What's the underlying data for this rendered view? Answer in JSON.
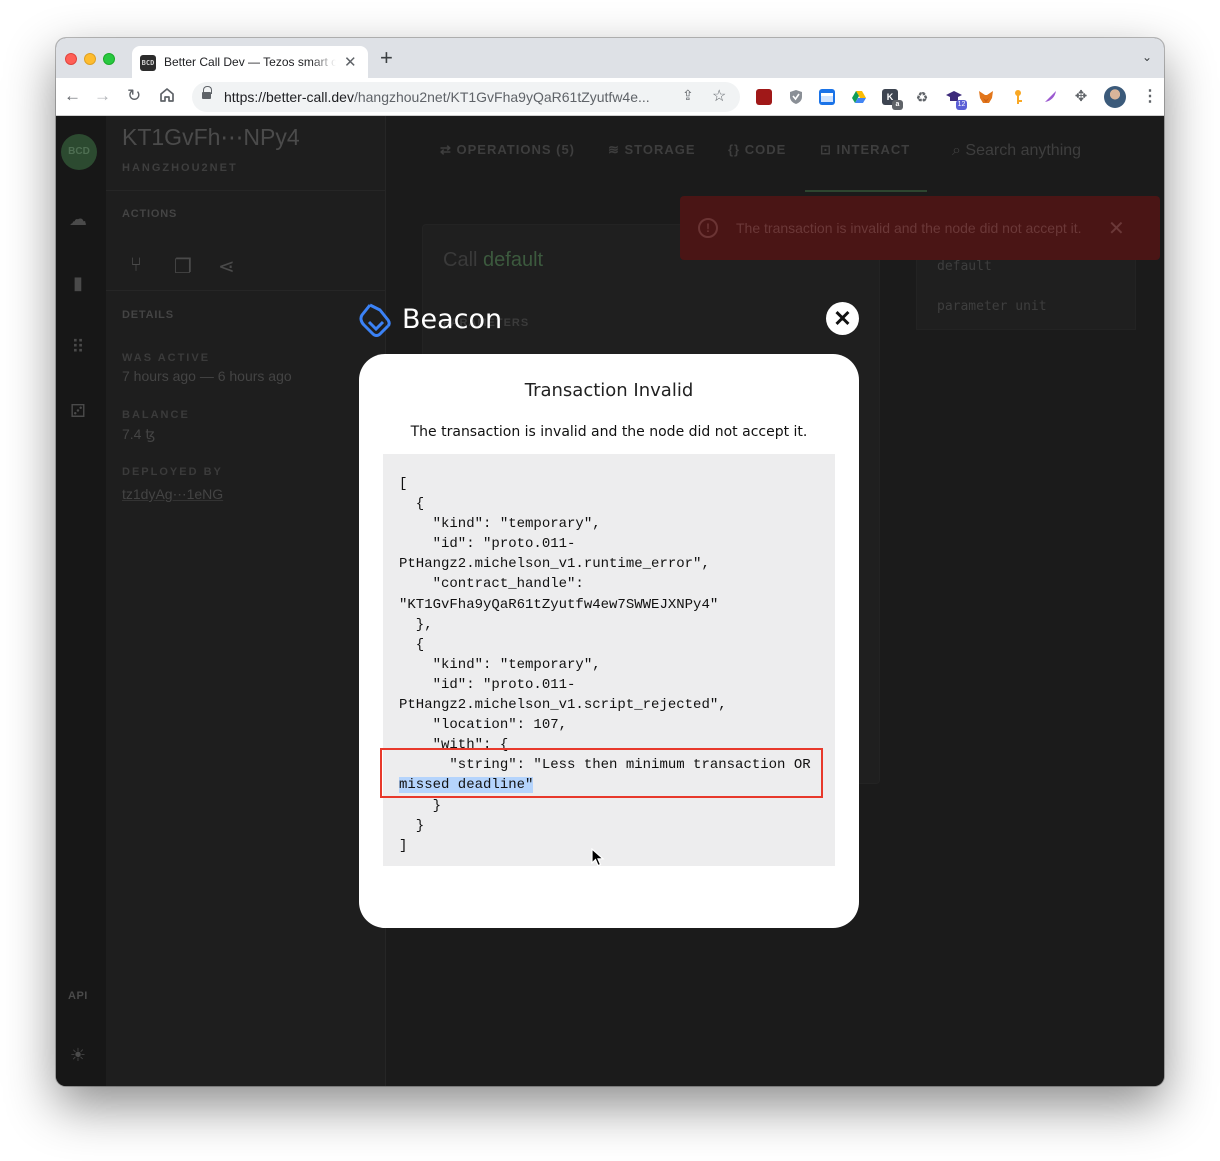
{
  "browser": {
    "tab_title": "Better Call Dev — Tezos smart contract explorer",
    "tab_favicon_text": "BCD",
    "url_host": "https://better-call.dev",
    "url_path": "/hangzhou2net/KT1GvFha9yQaR61tZyutfw4e...",
    "extension_badges": {
      "ext5": "a",
      "ext7": "12"
    }
  },
  "app": {
    "contract_title": "KT1GvFh⋯NPy4",
    "network": "HANGZHOU2NET",
    "actions_label": "ACTIONS",
    "details_label": "DETAILS",
    "was_active_label": "WAS ACTIVE",
    "was_active_value": "7 hours ago — 6 hours ago",
    "balance_label": "BALANCE",
    "balance_value": "7.4 ꜩ",
    "deployed_by_label": "DEPLOYED BY",
    "deployed_by_value": "tz1dyAg⋯1eNG",
    "api_label": "API",
    "tabs": [
      {
        "label": "OPERATIONS (5)",
        "icon": "swap-icon"
      },
      {
        "label": "STORAGE",
        "icon": "database-icon"
      },
      {
        "label": "CODE",
        "icon": "braces-icon"
      },
      {
        "label": "INTERACT",
        "icon": "interact-icon"
      }
    ],
    "search_placeholder": "Search anything",
    "call_prefix": "Call",
    "call_entrypoint": "default",
    "parameters_label": "PARAMETERS",
    "side_entry": "default",
    "side_param": "parameter unit",
    "snackbar_text": "The transaction is invalid and the node did not accept it."
  },
  "beacon": {
    "brand": "Beacon",
    "modal_title": "Transaction Invalid",
    "modal_description": "The transaction is invalid and the node did not accept it.",
    "code_lines_before": "[\n  {\n    \"kind\": \"temporary\",\n    \"id\": \"proto.011-\nPtHangz2.michelson_v1.runtime_error\",\n    \"contract_handle\":\n\"KT1GvFha9yQaR61tZyutfw4ew7SWWEJXNPy4\"\n  },\n  {\n    \"kind\": \"temporary\",\n    \"id\": \"proto.011-\nPtHangz2.michelson_v1.script_rejected\",\n    \"location\": 107,\n    \"with\": {\n      \"string\": \"Less then minimum transaction OR\n",
    "code_highlight": "missed deadline\"",
    "code_lines_after": "\n    }\n  }\n]"
  },
  "colors": {
    "beacon_blue": "#3b82f6",
    "highlight_box": "#e8392b",
    "selection": "#b5d4fc",
    "snackbar_bg": "#4a1515"
  }
}
